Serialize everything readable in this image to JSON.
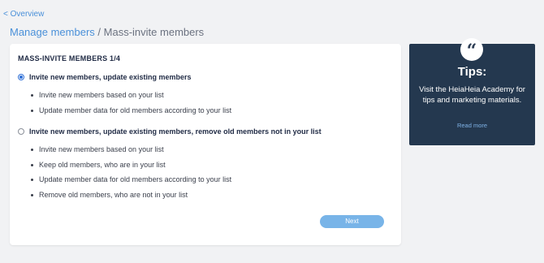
{
  "nav": {
    "back_label": "< Overview"
  },
  "breadcrumb": {
    "parent": "Manage members",
    "separator": "/",
    "current": "Mass-invite members"
  },
  "card": {
    "title": "MASS-INVITE MEMBERS 1/4",
    "options": [
      {
        "label": "Invite new members, update existing members",
        "selected": true,
        "bullets": [
          "Invite new members based on your list",
          "Update member data for old members according to your list"
        ]
      },
      {
        "label": "Invite new members, update existing members, remove old members not in your list",
        "selected": false,
        "bullets": [
          "Invite new members based on your list",
          "Keep old members, who are in your list",
          "Update member data for old members according to your list",
          "Remove old members, who are not in your list"
        ]
      }
    ],
    "next_label": "Next"
  },
  "tips": {
    "icon": "quote-icon",
    "title": "Tips:",
    "body": "Visit the HeiaHeia Academy for tips and marketing materials.",
    "read_more": "Read more"
  },
  "colors": {
    "background": "#f1f2f4",
    "link": "#4a90d9",
    "accent": "#2f6fd6",
    "button": "#78b4e8",
    "tips_panel": "#24384f"
  }
}
